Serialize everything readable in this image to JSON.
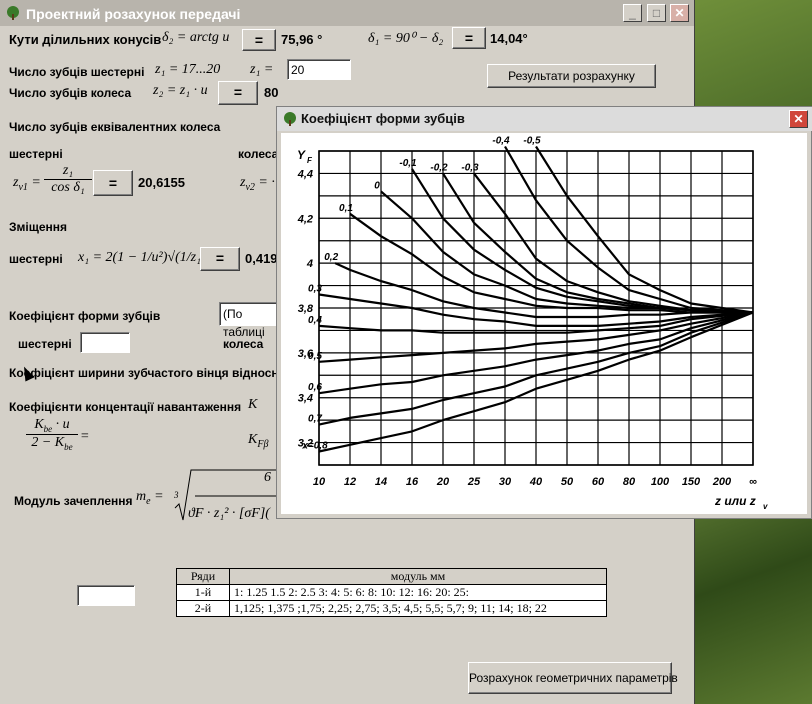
{
  "window": {
    "title": "Проектний розахунок передачі"
  },
  "cones": {
    "label": "Кути ділильних конусів",
    "delta2_formula": "δ₂ = arctg u",
    "delta2_value": "75,96 °",
    "delta1_formula": "δ₁ = 90⁰ − δ₂",
    "delta1_value": "14,04°"
  },
  "teeth": {
    "pinion_label": "Число зубців шестерні",
    "pinion_range": "z₁ = 17...20",
    "pinion_eq": "z₁ =",
    "pinion_input": "20",
    "wheel_label": "Число зубців колеса",
    "wheel_formula": "z₂ = z₁ · u",
    "wheel_value": "80",
    "results_button": "Результати розрахунку"
  },
  "equivalent": {
    "label": "Число зубців еквівалентних колеса",
    "pinion_sub": "шестерні",
    "wheel_sub": "колеса",
    "zv1": "z",
    "zv1_num": "z₁",
    "zv1_den": "cos δ₁",
    "zv1_value": "20,6155",
    "zv2_prefix": "z",
    "zv2_sub": "v2",
    "zv2_suffix": "= ·"
  },
  "shift": {
    "label": "Зміщення",
    "pinion": "шестерні",
    "formula": "x₁ = 2(1 − 1/u²)√(1/z₁)",
    "value": "0,419"
  },
  "form_factor": {
    "label": "Коефіцієнт форми зубців",
    "dropdown": "(По таблиці",
    "pinion": "шестерні",
    "wheel": "колеса"
  },
  "width_coef": {
    "label": "Коефіцієнт ширини зубчастого вінця відносно"
  },
  "concentration": {
    "label": "Коефіцієнти концентації навантаження",
    "khb": "K",
    "kfb": "K",
    "kfb_sub": "Fβ",
    "num": "K",
    "num_sub": "be",
    "num_tail": " · u",
    "den": "2 − K",
    "den_sub": "be",
    "eq": "="
  },
  "module": {
    "label": "Модуль зачеплення",
    "formula_left": "m",
    "formula_sub": "e",
    "formula_eq": "=",
    "formula_root": "3",
    "num": "6",
    "den": "ϑF · z₁² · [σF]("
  },
  "buttons": {
    "eq": "=",
    "geometry": "Розрахунок геометричних параметрів"
  },
  "module_table": {
    "headers": [
      "Ряди",
      "модуль  мм"
    ],
    "rows": [
      [
        "1-й",
        "1:  1.25  1.5  2:  2.5  3:  4:  5:  6:  8:  10:  12:  16:  20:  25:"
      ],
      [
        "2-й",
        "1,125;  1,375 ;1,75;  2,25;  2,75;  3,5;  4,5;  5,5;  5,7; 9;  11;  14;  18;  22"
      ]
    ]
  },
  "chart_window": {
    "title": "Коефіцієнт форми зубців"
  },
  "chart_data": {
    "type": "line",
    "ylabel": "Y",
    "ylabel_sub": "F",
    "xlabel": "z или z",
    "xlabel_sub": "v",
    "x_ticks": [
      "10",
      "12",
      "14",
      "16",
      "20",
      "25",
      "30",
      "40",
      "50",
      "60",
      "80",
      "100",
      "150",
      "200",
      "∞"
    ],
    "y_ticks": [
      "3,2",
      "3,4",
      "3,6",
      "3,8",
      "4",
      "4,2",
      "4,4"
    ],
    "ylim": [
      3.1,
      4.5
    ],
    "grid": true,
    "converge": {
      "x": "∞",
      "y": 3.78
    },
    "series": [
      {
        "name": "-0,5",
        "points": [
          [
            40,
            4.52
          ],
          [
            50,
            4.3
          ],
          [
            60,
            4.12
          ],
          [
            80,
            3.95
          ],
          [
            100,
            3.88
          ],
          [
            150,
            3.82
          ]
        ]
      },
      {
        "name": "-0,4",
        "points": [
          [
            30,
            4.52
          ],
          [
            40,
            4.28
          ],
          [
            50,
            4.1
          ],
          [
            60,
            3.98
          ],
          [
            80,
            3.88
          ],
          [
            100,
            3.84
          ],
          [
            150,
            3.8
          ]
        ]
      },
      {
        "name": "-0,3",
        "points": [
          [
            25,
            4.4
          ],
          [
            30,
            4.22
          ],
          [
            40,
            4.02
          ],
          [
            50,
            3.92
          ],
          [
            60,
            3.87
          ],
          [
            80,
            3.83
          ],
          [
            100,
            3.81
          ],
          [
            150,
            3.79
          ]
        ]
      },
      {
        "name": "-0,2",
        "points": [
          [
            20,
            4.4
          ],
          [
            25,
            4.18
          ],
          [
            30,
            4.05
          ],
          [
            40,
            3.93
          ],
          [
            50,
            3.87
          ],
          [
            60,
            3.84
          ],
          [
            80,
            3.82
          ],
          [
            100,
            3.8
          ],
          [
            150,
            3.79
          ]
        ]
      },
      {
        "name": "-0,1",
        "points": [
          [
            16,
            4.42
          ],
          [
            20,
            4.2
          ],
          [
            25,
            4.06
          ],
          [
            30,
            3.97
          ],
          [
            40,
            3.89
          ],
          [
            50,
            3.85
          ],
          [
            60,
            3.83
          ],
          [
            80,
            3.81
          ],
          [
            100,
            3.8
          ],
          [
            150,
            3.79
          ]
        ]
      },
      {
        "name": "0",
        "points": [
          [
            14,
            4.32
          ],
          [
            16,
            4.2
          ],
          [
            20,
            4.05
          ],
          [
            25,
            3.95
          ],
          [
            30,
            3.9
          ],
          [
            40,
            3.84
          ],
          [
            50,
            3.82
          ],
          [
            60,
            3.81
          ],
          [
            80,
            3.8
          ],
          [
            100,
            3.8
          ],
          [
            150,
            3.79
          ]
        ]
      },
      {
        "name": "0,1",
        "points": [
          [
            12,
            4.22
          ],
          [
            14,
            4.12
          ],
          [
            16,
            4.04
          ],
          [
            20,
            3.94
          ],
          [
            25,
            3.87
          ],
          [
            30,
            3.84
          ],
          [
            40,
            3.81
          ],
          [
            50,
            3.8
          ],
          [
            60,
            3.8
          ],
          [
            80,
            3.79
          ],
          [
            100,
            3.79
          ],
          [
            150,
            3.78
          ]
        ]
      },
      {
        "name": "0,2",
        "points": [
          [
            11,
            4.0
          ],
          [
            12,
            3.97
          ],
          [
            14,
            3.92
          ],
          [
            16,
            3.88
          ],
          [
            20,
            3.83
          ],
          [
            25,
            3.8
          ],
          [
            30,
            3.78
          ],
          [
            40,
            3.76
          ],
          [
            50,
            3.76
          ],
          [
            60,
            3.76
          ],
          [
            80,
            3.77
          ],
          [
            100,
            3.77
          ],
          [
            150,
            3.78
          ]
        ]
      },
      {
        "name": "0,3",
        "points": [
          [
            10,
            3.86
          ],
          [
            12,
            3.84
          ],
          [
            14,
            3.82
          ],
          [
            16,
            3.8
          ],
          [
            20,
            3.77
          ],
          [
            25,
            3.75
          ],
          [
            30,
            3.74
          ],
          [
            40,
            3.72
          ],
          [
            50,
            3.72
          ],
          [
            60,
            3.72
          ],
          [
            80,
            3.73
          ],
          [
            100,
            3.74
          ],
          [
            150,
            3.76
          ]
        ]
      },
      {
        "name": "0,4",
        "points": [
          [
            10,
            3.72
          ],
          [
            12,
            3.71
          ],
          [
            14,
            3.7
          ],
          [
            16,
            3.7
          ],
          [
            20,
            3.69
          ],
          [
            25,
            3.69
          ],
          [
            30,
            3.69
          ],
          [
            40,
            3.69
          ],
          [
            50,
            3.69
          ],
          [
            60,
            3.7
          ],
          [
            80,
            3.71
          ],
          [
            100,
            3.72
          ],
          [
            150,
            3.75
          ]
        ]
      },
      {
        "name": "0,5",
        "points": [
          [
            10,
            3.56
          ],
          [
            12,
            3.57
          ],
          [
            14,
            3.58
          ],
          [
            16,
            3.59
          ],
          [
            20,
            3.6
          ],
          [
            25,
            3.61
          ],
          [
            30,
            3.62
          ],
          [
            40,
            3.64
          ],
          [
            50,
            3.65
          ],
          [
            60,
            3.66
          ],
          [
            80,
            3.68
          ],
          [
            100,
            3.7
          ],
          [
            150,
            3.73
          ]
        ]
      },
      {
        "name": "0,6",
        "points": [
          [
            10,
            3.42
          ],
          [
            12,
            3.44
          ],
          [
            14,
            3.46
          ],
          [
            16,
            3.47
          ],
          [
            20,
            3.5
          ],
          [
            25,
            3.52
          ],
          [
            30,
            3.54
          ],
          [
            40,
            3.57
          ],
          [
            50,
            3.59
          ],
          [
            60,
            3.61
          ],
          [
            80,
            3.64
          ],
          [
            100,
            3.66
          ],
          [
            150,
            3.71
          ]
        ]
      },
      {
        "name": "0,7",
        "points": [
          [
            10,
            3.28
          ],
          [
            12,
            3.31
          ],
          [
            14,
            3.33
          ],
          [
            16,
            3.35
          ],
          [
            20,
            3.39
          ],
          [
            25,
            3.42
          ],
          [
            30,
            3.45
          ],
          [
            40,
            3.5
          ],
          [
            50,
            3.53
          ],
          [
            60,
            3.56
          ],
          [
            80,
            3.6
          ],
          [
            100,
            3.63
          ],
          [
            150,
            3.69
          ]
        ]
      },
      {
        "name": "x=0,8",
        "points": [
          [
            10,
            3.16
          ],
          [
            12,
            3.19
          ],
          [
            14,
            3.22
          ],
          [
            16,
            3.25
          ],
          [
            20,
            3.3
          ],
          [
            25,
            3.34
          ],
          [
            30,
            3.38
          ],
          [
            40,
            3.44
          ],
          [
            50,
            3.48
          ],
          [
            60,
            3.52
          ],
          [
            80,
            3.57
          ],
          [
            100,
            3.61
          ],
          [
            150,
            3.67
          ]
        ]
      }
    ]
  }
}
